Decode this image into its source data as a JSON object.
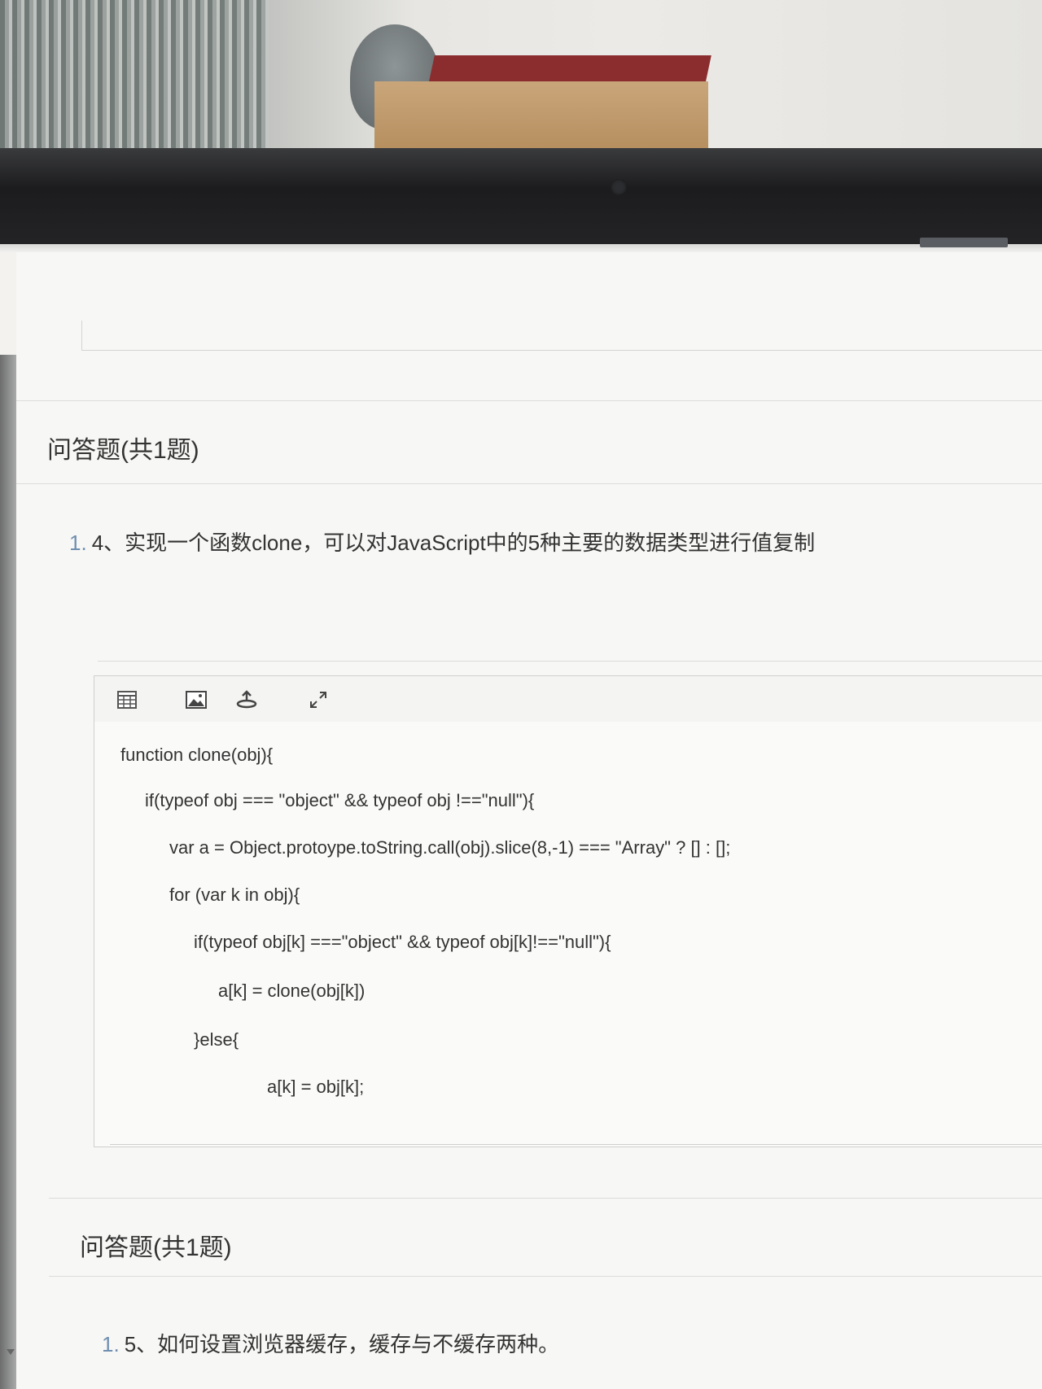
{
  "sections": [
    {
      "title": "问答题(共1题)",
      "question": {
        "number": "1.",
        "text": "4、实现一个函数clone，可以对JavaScript中的5种主要的数据类型进行值复制"
      },
      "editor": {
        "toolbar": [
          "table-icon",
          "image-icon",
          "upload-icon",
          "fullscreen-icon"
        ],
        "lines": [
          "function clone(obj){",
          "if(typeof obj === \"object\" && typeof obj !==\"null\"){",
          "var a = Object.protoype.toString.call(obj).slice(8,-1) === \"Array\" ? [] : [];",
          "for (var k in obj){",
          "if(typeof obj[k] ===\"object\" && typeof obj[k]!==\"null\"){",
          "a[k] = clone(obj[k])",
          "}else{",
          "a[k] = obj[k];"
        ]
      }
    },
    {
      "title": "问答题(共1题)",
      "question": {
        "number": "1.",
        "text": "5、如何设置浏览器缓存，缓存与不缓存两种。"
      }
    }
  ]
}
